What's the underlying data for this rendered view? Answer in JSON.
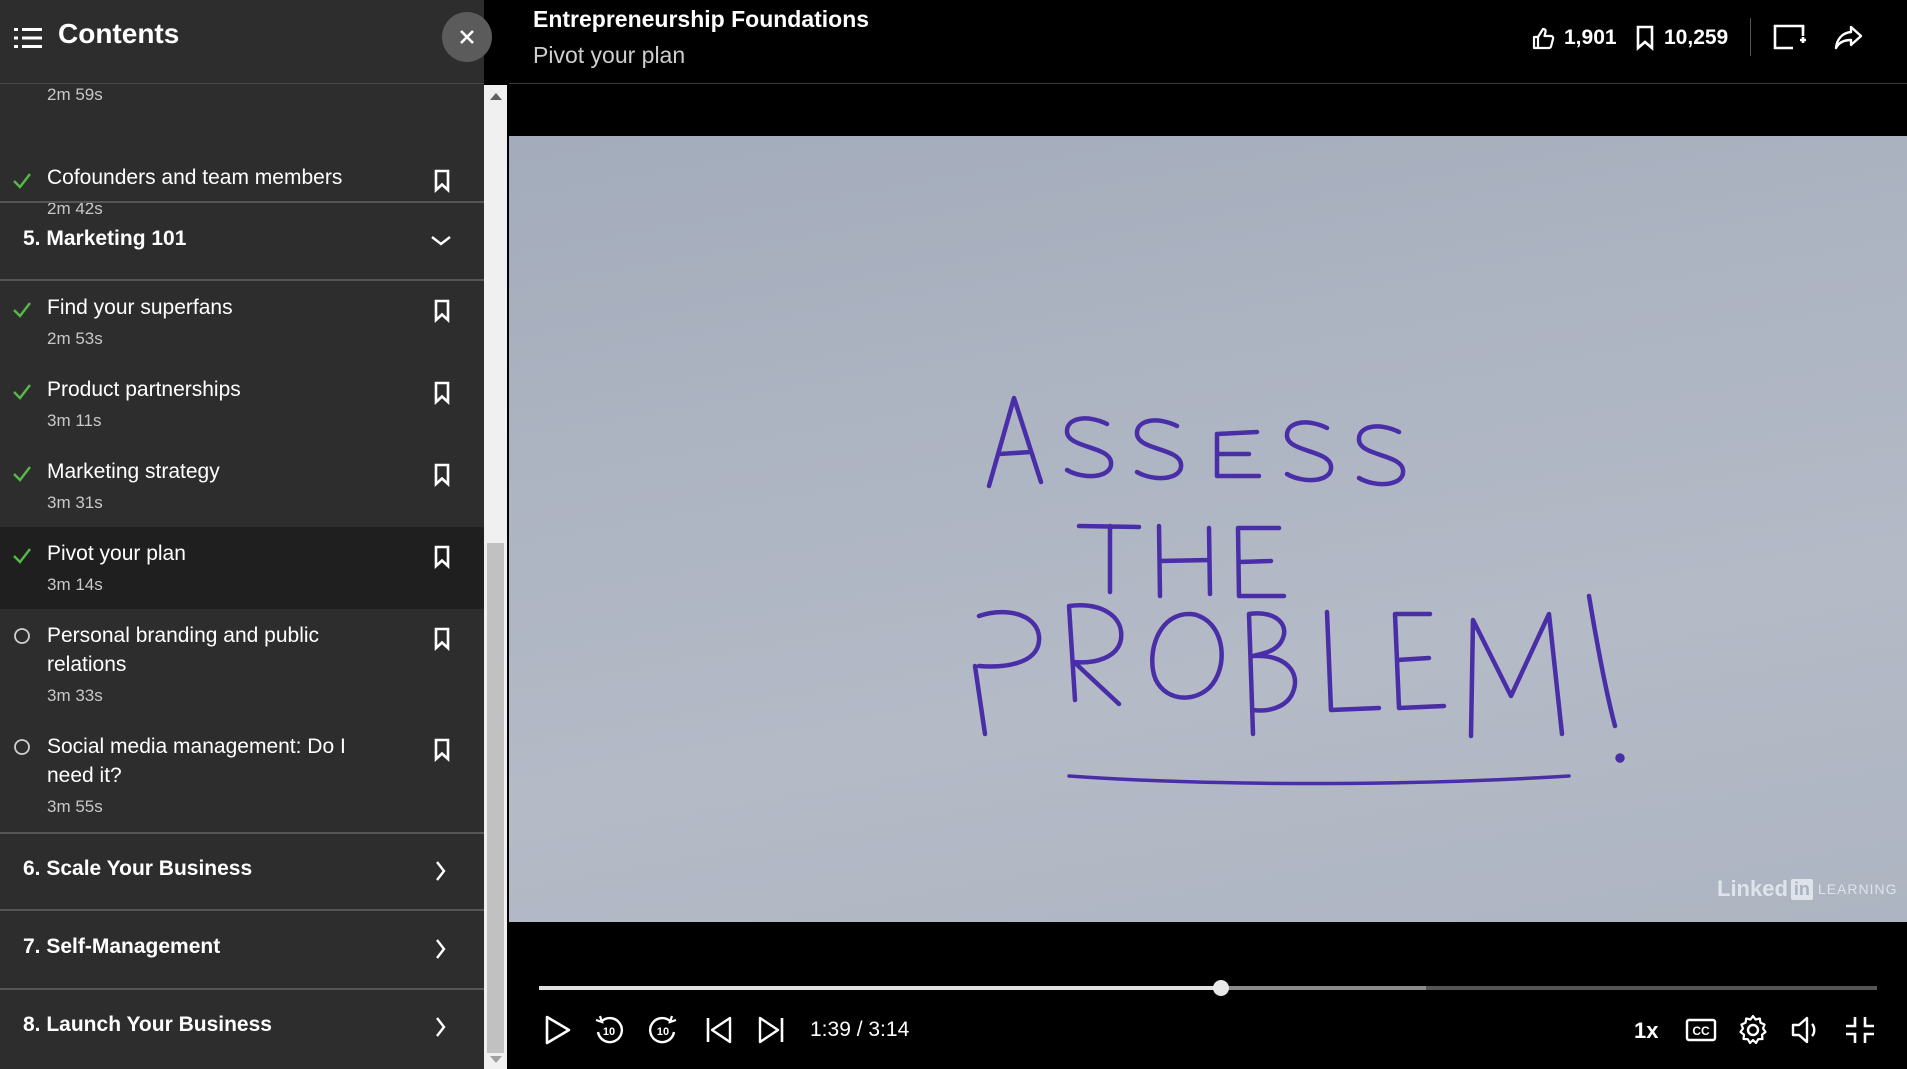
{
  "sidebar": {
    "title": "Contents",
    "top_partial_duration": "2m 59s",
    "lessons_top": [
      {
        "name": "Cofounders and team members",
        "duration": "2m 42s",
        "status": "done"
      }
    ],
    "sections": [
      {
        "label": "5. Marketing 101",
        "expanded": true
      },
      {
        "label": "6. Scale Your Business",
        "expanded": false
      },
      {
        "label": "7. Self-Management",
        "expanded": false
      },
      {
        "label": "8. Launch Your Business",
        "expanded": false
      }
    ],
    "lessons": [
      {
        "name": "Find your superfans",
        "duration": "2m 53s",
        "status": "done"
      },
      {
        "name": "Product partnerships",
        "duration": "3m 11s",
        "status": "done"
      },
      {
        "name": "Marketing strategy",
        "duration": "3m 31s",
        "status": "done"
      },
      {
        "name": "Pivot your plan",
        "duration": "3m 14s",
        "status": "done",
        "active": true
      },
      {
        "name": "Personal branding and public relations",
        "duration": "3m 33s",
        "status": "not-started"
      },
      {
        "name": "Social media management: Do I need it?",
        "duration": "3m 55s",
        "status": "not-started"
      }
    ]
  },
  "header": {
    "course_title": "Entrepreneurship Foundations",
    "video_title": "Pivot your plan",
    "likes": "1,901",
    "saves": "10,259"
  },
  "video": {
    "board_text": [
      "ASSESS",
      "THE",
      "PROBLEM!"
    ],
    "watermark_brand": "Linked",
    "watermark_in": "in",
    "watermark_learning": "LEARNING"
  },
  "player": {
    "time_display": "1:39 / 3:14",
    "played_fraction": 0.51,
    "buffered_fraction": 0.663,
    "speed": "1x"
  },
  "colors": {
    "check": "#57b84a",
    "sidebar_bg": "#2d2d2d",
    "marker_ink": "#4a2ea8"
  }
}
